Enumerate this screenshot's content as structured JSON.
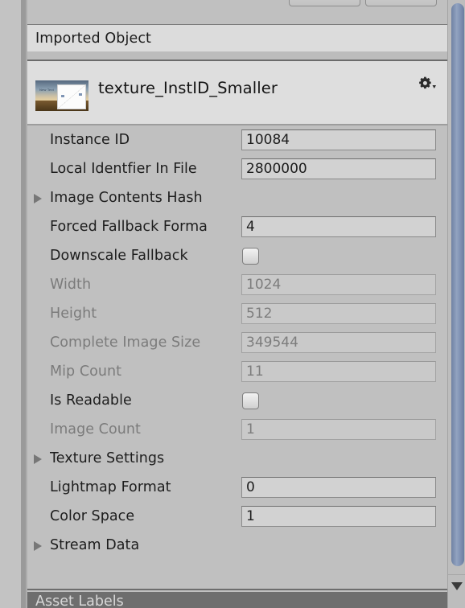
{
  "panel": {
    "section_header": "Imported Object",
    "object_name": "texture_InstID_Smaller",
    "thumbnail_caption": "New Text",
    "gear_icon": "gear-icon",
    "dropdown_icon": "chevron-down-icon"
  },
  "properties": [
    {
      "label": "Instance ID",
      "type": "text",
      "value": "10084",
      "disabled": false,
      "foldout": false
    },
    {
      "label": "Local Identfier In File",
      "type": "text",
      "value": "2800000",
      "disabled": false,
      "foldout": false
    },
    {
      "label": "Image Contents Hash",
      "type": "foldout",
      "value": "",
      "disabled": false,
      "foldout": true
    },
    {
      "label": "Forced Fallback Forma",
      "type": "text",
      "value": "4",
      "disabled": false,
      "foldout": false,
      "clipped": true
    },
    {
      "label": "Downscale Fallback",
      "type": "checkbox",
      "value": "",
      "disabled": false,
      "foldout": false,
      "checked": false
    },
    {
      "label": "Width",
      "type": "text",
      "value": "1024",
      "disabled": true,
      "foldout": false
    },
    {
      "label": "Height",
      "type": "text",
      "value": "512",
      "disabled": true,
      "foldout": false
    },
    {
      "label": "Complete Image Size",
      "type": "text",
      "value": "349544",
      "disabled": true,
      "foldout": false
    },
    {
      "label": "Mip Count",
      "type": "text",
      "value": "11",
      "disabled": true,
      "foldout": false
    },
    {
      "label": "Is Readable",
      "type": "checkbox",
      "value": "",
      "disabled": false,
      "foldout": false,
      "checked": false
    },
    {
      "label": "Image Count",
      "type": "text",
      "value": "1",
      "disabled": true,
      "foldout": false
    },
    {
      "label": "Texture Settings",
      "type": "foldout",
      "value": "",
      "disabled": false,
      "foldout": true
    },
    {
      "label": "Lightmap Format",
      "type": "text",
      "value": "0",
      "disabled": false,
      "foldout": false
    },
    {
      "label": "Color Space",
      "type": "text",
      "value": "1",
      "disabled": false,
      "foldout": false
    },
    {
      "label": "Stream Data",
      "type": "foldout",
      "value": "",
      "disabled": false,
      "foldout": true
    }
  ],
  "footer": {
    "asset_labels": "Asset Labels"
  },
  "scrollbar": {
    "down_arrow_icon": "triangle-down-icon"
  },
  "colors": {
    "panel_background": "#c0c0c0",
    "header_background": "#dcdcdc",
    "object_bar_background": "#dedede",
    "field_background": "#d2d2d2",
    "field_disabled_background": "#c9c9c9",
    "text": "#1d1d1d",
    "text_disabled": "#7b7b7b",
    "scrollbar_thumb": "#8496b8",
    "footer_background": "#6e6e6e"
  }
}
